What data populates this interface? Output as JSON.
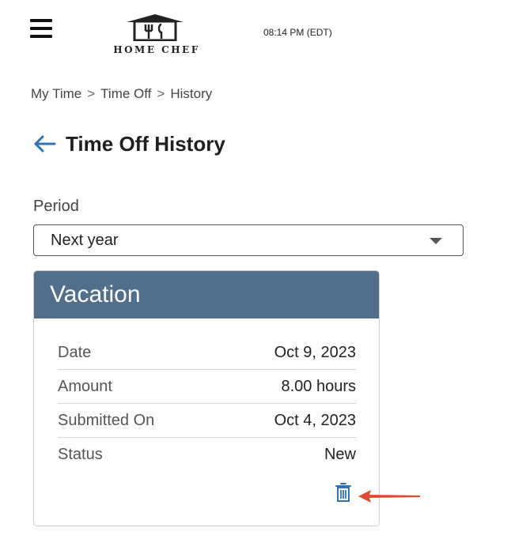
{
  "header": {
    "logo_text": "HOME CHEF",
    "clock": "08:14 PM (EDT)"
  },
  "breadcrumb": {
    "items": [
      "My Time",
      "Time Off",
      "History"
    ],
    "separator": ">"
  },
  "page": {
    "title": "Time Off History"
  },
  "period": {
    "label": "Period",
    "selected": "Next year"
  },
  "card": {
    "type": "Vacation",
    "rows": [
      {
        "label": "Date",
        "value": "Oct 9, 2023"
      },
      {
        "label": "Amount",
        "value": "8.00 hours"
      },
      {
        "label": "Submitted On",
        "value": "Oct 4, 2023"
      },
      {
        "label": "Status",
        "value": "New"
      }
    ]
  },
  "colors": {
    "card_header": "#516f8c",
    "accent_blue": "#2f73b5",
    "annotation_red": "#e04a2f"
  },
  "icons": [
    "menu-icon",
    "logo-icon",
    "back-arrow-icon",
    "chevron-down-icon",
    "trash-icon",
    "annotation-arrow-icon"
  ]
}
